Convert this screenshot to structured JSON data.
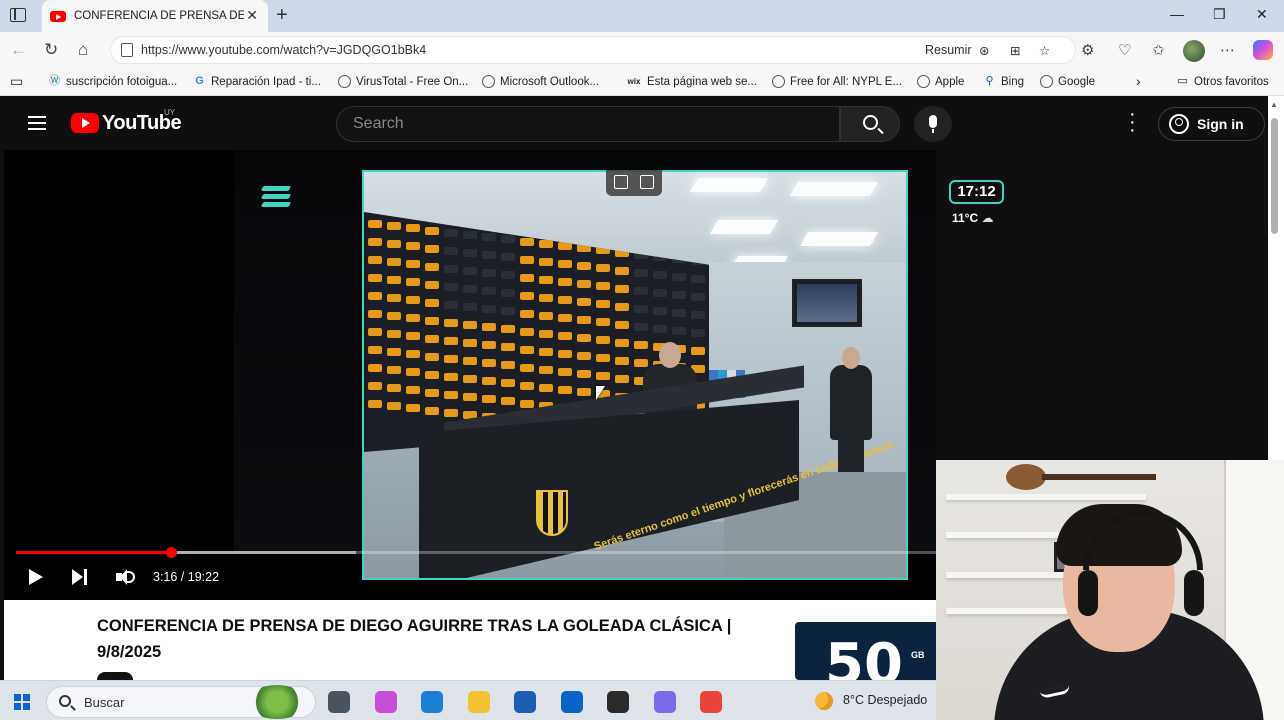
{
  "browser": {
    "tab_title": "CONFERENCIA DE PRENSA DE DIEGO AGUIRRE TRAS LA GOLEADA CLÁSICA",
    "url": "https://www.youtube.com/watch?v=JGDQGO1bBk4",
    "summarize_label": "Resumir",
    "bookmarks": [
      {
        "label": "suscripción fotoigua...",
        "icon": "wordpress-icon"
      },
      {
        "label": "Reparación Ipad - ti...",
        "icon": "google-icon"
      },
      {
        "label": "VirusTotal - Free On...",
        "icon": "globe-icon"
      },
      {
        "label": "Microsoft Outlook...",
        "icon": "globe-icon"
      },
      {
        "label": "Esta página web se...",
        "icon": "wix-icon"
      },
      {
        "label": "Free for All: NYPL E...",
        "icon": "globe-icon"
      },
      {
        "label": "Apple",
        "icon": "globe-icon"
      },
      {
        "label": "Bing",
        "icon": "bing-search-icon"
      },
      {
        "label": "Google",
        "icon": "globe-icon"
      }
    ],
    "other_favorites": "Otros favoritos"
  },
  "youtube": {
    "logo_text": "YouTube",
    "region": "UY",
    "search_placeholder": "Search",
    "sign_in": "Sign in"
  },
  "video": {
    "overlay_clock": "17:12",
    "overlay_weather": "11°C",
    "desk_slogan": "Serás eterno como el tiempo y florecerás en cada primavera",
    "current_time": "3:16",
    "duration": "19:22",
    "timecode": "3:16 / 19:22",
    "progress_fraction": 0.169,
    "buffer_fraction": 0.37,
    "title": "CONFERENCIA DE PRENSA DE DIEGO AGUIRRE TRAS LA GOLEADA CLÁSICA | 9/8/2025"
  },
  "ad": {
    "big_text": "50",
    "unit": "GB"
  },
  "taskbar": {
    "search_label": "Buscar",
    "weather": "8°C  Despejado",
    "apps": [
      {
        "name": "task-view-icon",
        "color": "#4a5560"
      },
      {
        "name": "copilot-app-icon",
        "color": "#c64fd6"
      },
      {
        "name": "edge-app-icon",
        "color": "#1b7fd6"
      },
      {
        "name": "file-explorer-icon",
        "color": "#f2c230"
      },
      {
        "name": "microsoft-store-icon",
        "color": "#1f5fb3"
      },
      {
        "name": "outlook-app-icon",
        "color": "#0a64c8"
      },
      {
        "name": "obs-app-icon",
        "color": "#2a2a2a"
      },
      {
        "name": "discord-app-icon",
        "color": "#7a6be8"
      },
      {
        "name": "chrome-app-icon",
        "color": "#e8453c"
      }
    ]
  }
}
